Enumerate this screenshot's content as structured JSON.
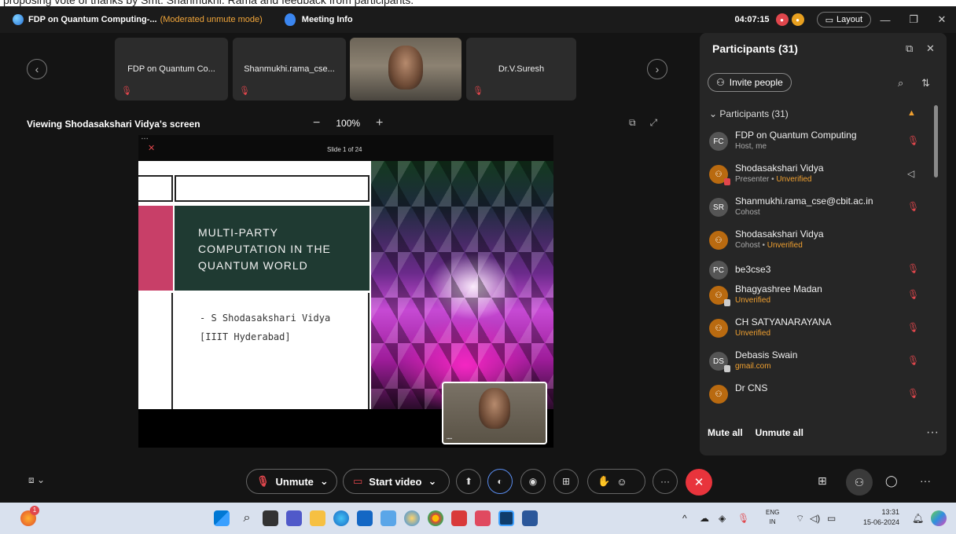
{
  "caption": "proposing vote of thanks by Smt. Shanmukhi. Rama and feedback from participants.",
  "titlebar": {
    "meeting_title": "FDP on Quantum Computing-...",
    "mode": "(Moderated unmute mode)",
    "meeting_info": "Meeting Info",
    "timer": "04:07:15",
    "layout_label": "Layout"
  },
  "strip": {
    "tiles": [
      {
        "name": "FDP on Quantum Co..."
      },
      {
        "name": "Shanmukhi.rama_cse..."
      },
      {
        "name": "Dr.V.Suresh"
      }
    ]
  },
  "viewing": {
    "label": "Viewing Shodasakshari Vidya's screen",
    "zoom": "100%"
  },
  "share": {
    "slide_counter": "Slide 1 of 24",
    "slide_title": "MULTI-PARTY COMPUTATION IN THE QUANTUM WORLD",
    "author_line1": "- S Shodasakshari Vidya",
    "author_line2": "[IIIT Hyderabad]"
  },
  "panel": {
    "title": "Participants (31)",
    "invite": "Invite people",
    "section": "Participants (31)",
    "mute_all": "Mute all",
    "unmute_all": "Unmute all",
    "participants": [
      {
        "initials": "FC",
        "name": "FDP on Quantum Computing",
        "sub": "Host, me",
        "unv": ""
      },
      {
        "initials": "",
        "name": "Shodasakshari Vidya",
        "sub": "Presenter • ",
        "unv": "Unverified"
      },
      {
        "initials": "SR",
        "name": "Shanmukhi.rama_cse@cbit.ac.in",
        "sub": "Cohost",
        "unv": ""
      },
      {
        "initials": "",
        "name": "Shodasakshari Vidya",
        "sub": "Cohost • ",
        "unv": "Unverified"
      },
      {
        "initials": "PC",
        "name": "be3cse3",
        "sub": "",
        "unv": ""
      },
      {
        "initials": "",
        "name": "Bhagyashree Madan",
        "sub": "",
        "unv": "Unverified"
      },
      {
        "initials": "",
        "name": "CH SATYANARAYANA",
        "sub": "",
        "unv": "Unverified"
      },
      {
        "initials": "DS",
        "name": "Debasis Swain",
        "sub": "",
        "unv": "gmail.com"
      },
      {
        "initials": "",
        "name": "Dr CNS",
        "sub": "",
        "unv": ""
      }
    ]
  },
  "controls": {
    "unmute": "Unmute",
    "start_video": "Start video"
  },
  "taskbar": {
    "lang1": "ENG",
    "lang2": "IN",
    "time": "13:31",
    "date": "15-06-2024",
    "badge": "1"
  }
}
